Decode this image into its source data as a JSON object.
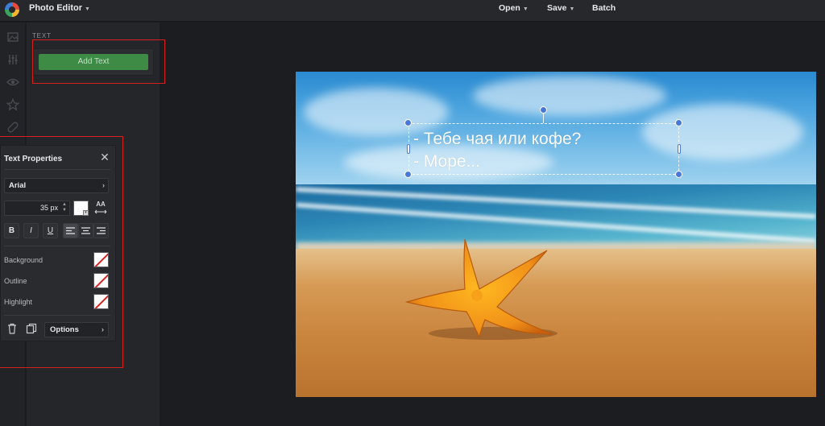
{
  "app": {
    "title": "Photo Editor"
  },
  "topbar": {
    "open_label": "Open",
    "save_label": "Save",
    "batch_label": "Batch"
  },
  "rail": {
    "icons": [
      "image-icon",
      "adjust-sliders-icon",
      "eye-icon",
      "star-icon",
      "bandage-icon",
      "text-icon"
    ]
  },
  "side_panel": {
    "section_label": "TEXT",
    "add_text_label": "Add Text",
    "add_text_color": "#3d8b45"
  },
  "text_properties": {
    "title": "Text Properties",
    "close_label": "✕",
    "font_family": "Arial",
    "font_size": "35 px",
    "text_color": "#ffffff",
    "size_toggle_label_top": "AA",
    "format_buttons": [
      "B",
      "I",
      "U"
    ],
    "alignment": "left",
    "background_label": "Background",
    "outline_label": "Outline",
    "highlight_label": "Highlight",
    "options_label": "Options"
  },
  "canvas": {
    "text_line_1": "- Тебе чая или кофе?",
    "text_line_2": "- Море..."
  },
  "colors": {
    "annotation_red": "#d5201e",
    "selection_handle": "#4a78d6"
  }
}
